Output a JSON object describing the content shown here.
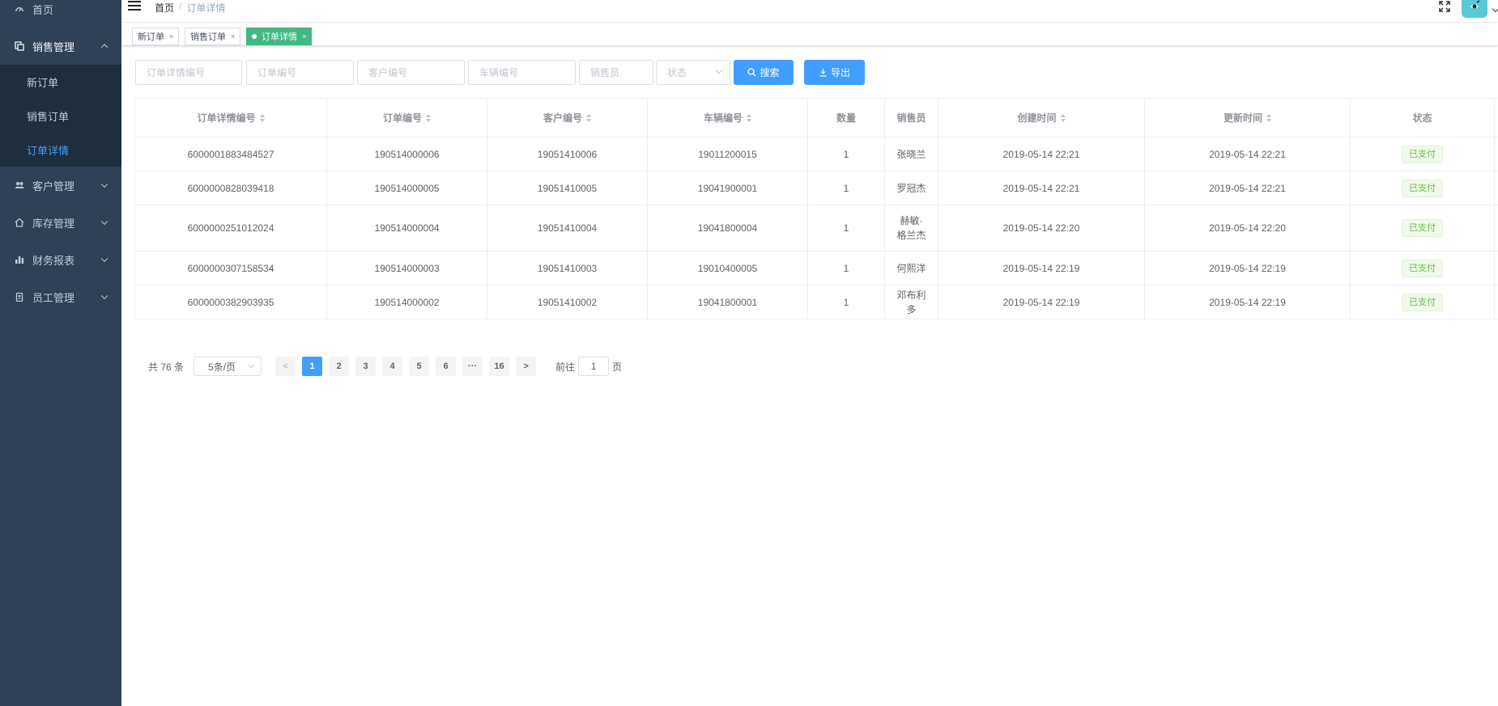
{
  "sidebar": {
    "items": [
      {
        "label": "首页",
        "icon": "dashboard-icon"
      },
      {
        "label": "销售管理",
        "icon": "documents-icon",
        "expanded": true,
        "children": [
          {
            "label": "新订单"
          },
          {
            "label": "销售订单"
          },
          {
            "label": "订单详情",
            "active": true
          }
        ]
      },
      {
        "label": "客户管理",
        "icon": "people-icon"
      },
      {
        "label": "库存管理",
        "icon": "warehouse-icon"
      },
      {
        "label": "财务报表",
        "icon": "chart-icon"
      },
      {
        "label": "员工管理",
        "icon": "badge-icon"
      }
    ]
  },
  "navbar": {
    "breadcrumb": {
      "home": "首页",
      "separator": "/",
      "current": "订单详情"
    }
  },
  "tags": [
    {
      "label": "新订单",
      "close": "×"
    },
    {
      "label": "销售订单",
      "close": "×"
    },
    {
      "label": "订单详情",
      "close": "×",
      "active": true
    }
  ],
  "filters": {
    "detail_id_placeholder": "订单详情编号",
    "order_id_placeholder": "订单编号",
    "customer_id_placeholder": "客户编号",
    "vehicle_id_placeholder": "车辆编号",
    "salesperson_placeholder": "销售员",
    "status_placeholder": "状态",
    "search_label": "搜索",
    "export_label": "导出"
  },
  "table": {
    "columns": [
      "订单详情编号",
      "订单编号",
      "客户编号",
      "车辆编号",
      "数量",
      "销售员",
      "创建时间",
      "更新时间",
      "状态"
    ],
    "rows": [
      {
        "detail_id": "6000001883484527",
        "order_id": "190514000006",
        "customer_id": "19051410006",
        "vehicle_id": "19011200015",
        "qty": "1",
        "salesperson": "张晓兰",
        "created": "2019-05-14 22:21",
        "updated": "2019-05-14 22:21",
        "status": "已支付"
      },
      {
        "detail_id": "6000000828039418",
        "order_id": "190514000005",
        "customer_id": "19051410005",
        "vehicle_id": "19041900001",
        "qty": "1",
        "salesperson": "罗冠杰",
        "created": "2019-05-14 22:21",
        "updated": "2019-05-14 22:21",
        "status": "已支付"
      },
      {
        "detail_id": "6000000251012024",
        "order_id": "190514000004",
        "customer_id": "19051410004",
        "vehicle_id": "19041800004",
        "qty": "1",
        "salesperson": "赫敏·格兰杰",
        "created": "2019-05-14 22:20",
        "updated": "2019-05-14 22:20",
        "status": "已支付"
      },
      {
        "detail_id": "6000000307158534",
        "order_id": "190514000003",
        "customer_id": "19051410003",
        "vehicle_id": "19010400005",
        "qty": "1",
        "salesperson": "何熙洋",
        "created": "2019-05-14 22:19",
        "updated": "2019-05-14 22:19",
        "status": "已支付"
      },
      {
        "detail_id": "6000000382903935",
        "order_id": "190514000002",
        "customer_id": "19051410002",
        "vehicle_id": "19041800001",
        "qty": "1",
        "salesperson": "邓布利多",
        "created": "2019-05-14 22:19",
        "updated": "2019-05-14 22:19",
        "status": "已支付"
      }
    ]
  },
  "pagination": {
    "total_text": "共 76 条",
    "page_size": "5条/页",
    "prev": "<",
    "pages": [
      "1",
      "2",
      "3",
      "4",
      "5",
      "6",
      "···",
      "16"
    ],
    "current_page": "1",
    "next": ">",
    "jump_prefix": "前往",
    "jump_value": "1",
    "jump_suffix": "页"
  },
  "colors": {
    "sidebar_bg": "#304156",
    "submenu_bg": "#1f2d3d",
    "primary": "#409eff",
    "tag_active": "#42b983",
    "success": "#67c23a"
  }
}
